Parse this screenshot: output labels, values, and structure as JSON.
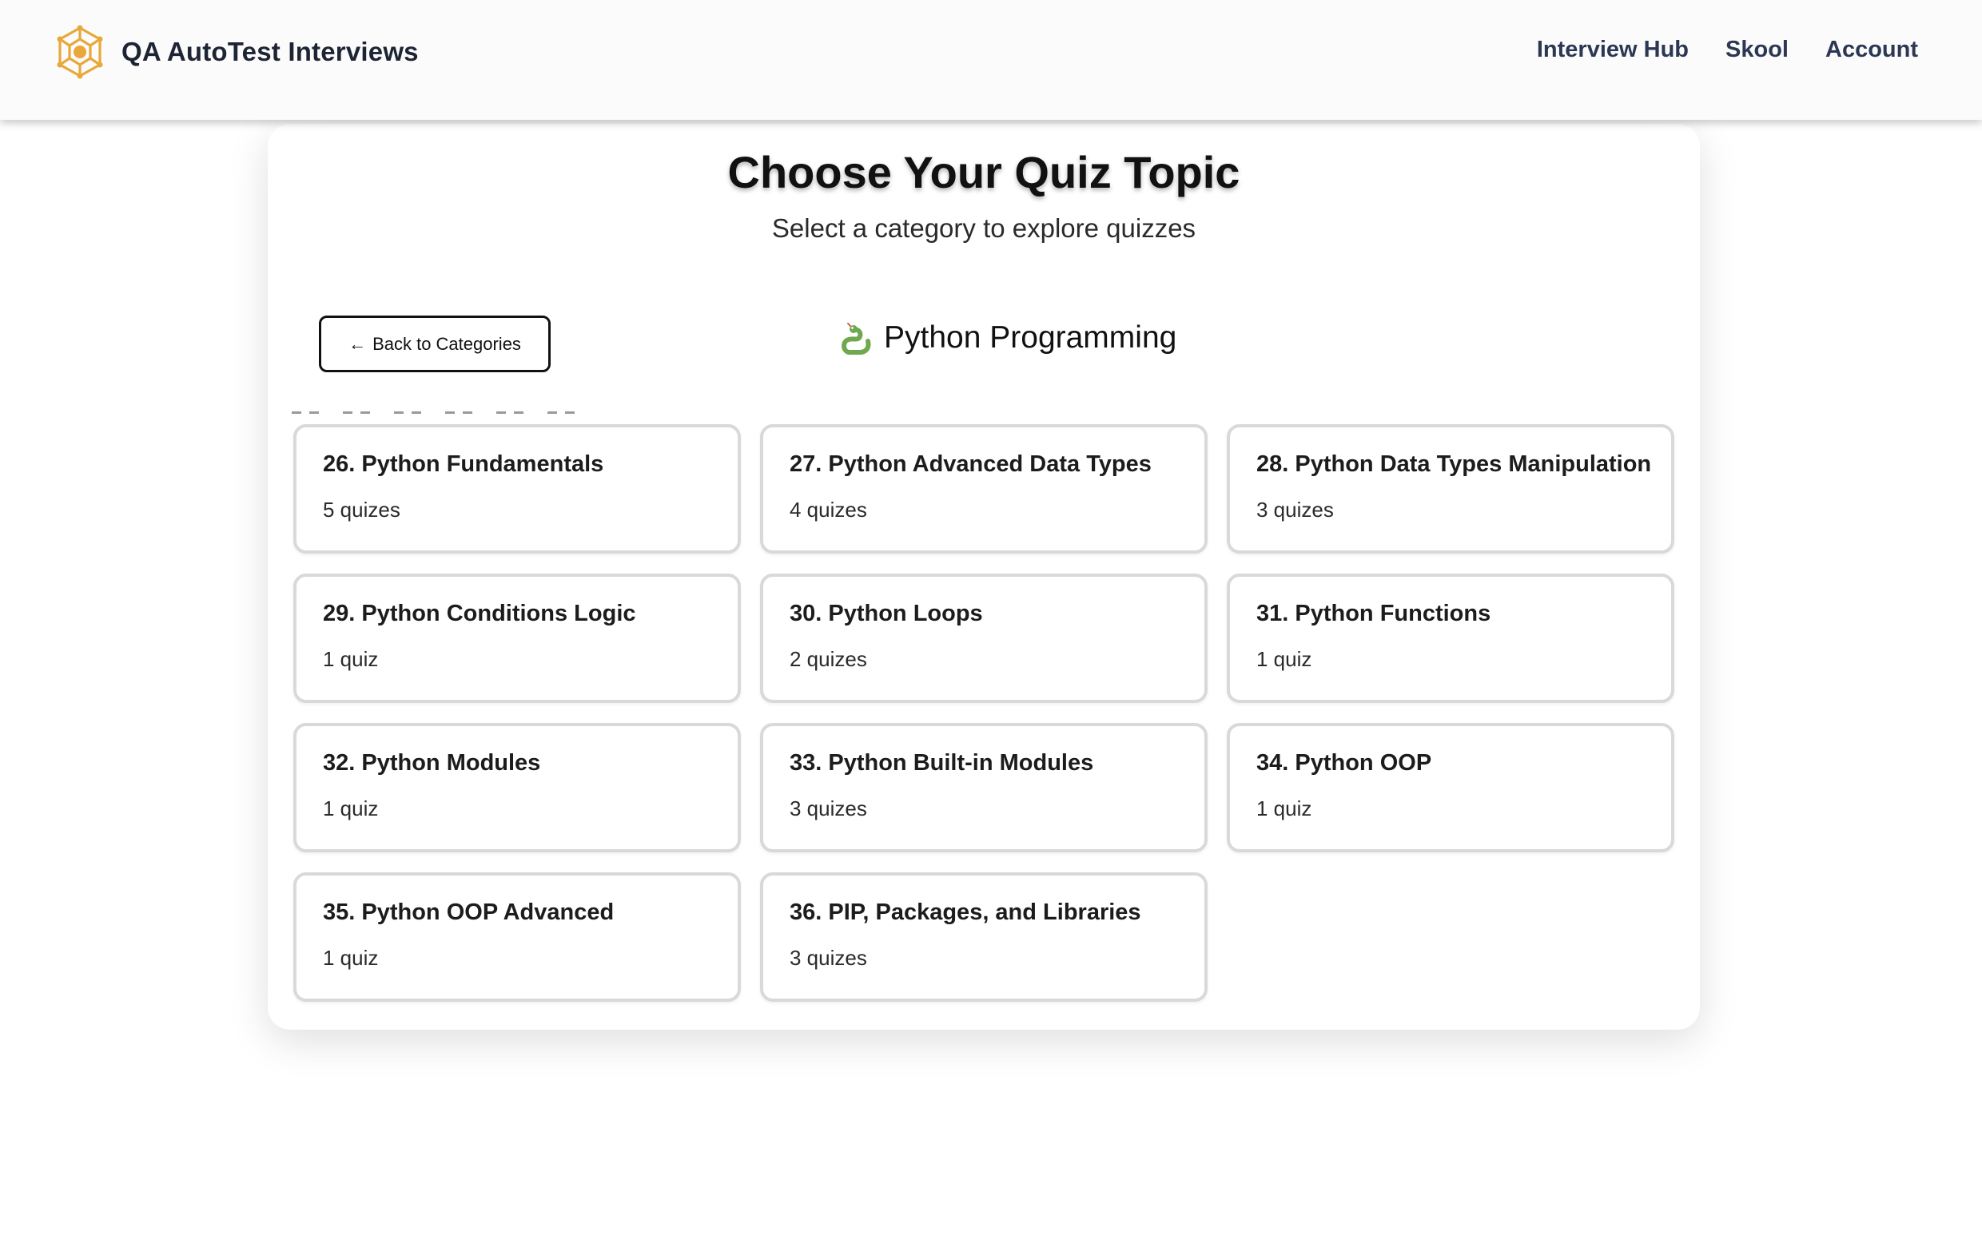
{
  "header": {
    "brand": "QA AutoTest Interviews",
    "nav": [
      "Interview Hub",
      "Skool",
      "Account"
    ],
    "colors": {
      "logo": "#e8a83a",
      "nav_text": "#2b3753"
    }
  },
  "page": {
    "title": "Choose Your Quiz Topic",
    "subtitle": "Select a category to explore quizzes"
  },
  "back_button": {
    "arrow": "←",
    "label": "Back to Categories"
  },
  "category": {
    "icon": "snake-icon",
    "name": "Python Programming"
  },
  "topics": [
    {
      "title": "26. Python Fundamentals",
      "count": "5 quizes"
    },
    {
      "title": "27. Python Advanced Data Types",
      "count": "4 quizes"
    },
    {
      "title": "28. Python Data Types Manipulation",
      "count": "3 quizes"
    },
    {
      "title": "29. Python Conditions Logic",
      "count": "1 quiz"
    },
    {
      "title": "30. Python Loops",
      "count": "2 quizes"
    },
    {
      "title": "31. Python Functions",
      "count": "1 quiz"
    },
    {
      "title": "32. Python Modules",
      "count": "1 quiz"
    },
    {
      "title": "33. Python Built-in Modules",
      "count": "3 quizes"
    },
    {
      "title": "34. Python OOP",
      "count": "1 quiz"
    },
    {
      "title": "35. Python OOP Advanced",
      "count": "1 quiz"
    },
    {
      "title": "36. PIP, Packages, and Libraries",
      "count": "3 quizes"
    }
  ]
}
